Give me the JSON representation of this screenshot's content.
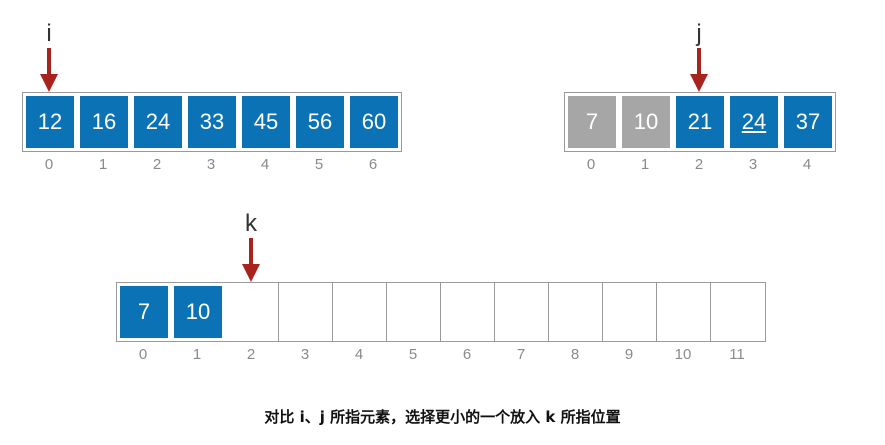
{
  "left": {
    "pointer": "i",
    "pointer_index": 0,
    "values": [
      "12",
      "16",
      "24",
      "33",
      "45",
      "56",
      "60"
    ],
    "indices": [
      "0",
      "1",
      "2",
      "3",
      "4",
      "5",
      "6"
    ]
  },
  "right": {
    "pointer": "j",
    "pointer_index": 2,
    "values": [
      "7",
      "10",
      "21",
      "24",
      "37"
    ],
    "indices": [
      "0",
      "1",
      "2",
      "3",
      "4"
    ],
    "consumed": 2,
    "underlined_index": 3
  },
  "merged": {
    "pointer": "k",
    "pointer_index": 2,
    "values": [
      "7",
      "10"
    ],
    "size": 12,
    "indices": [
      "0",
      "1",
      "2",
      "3",
      "4",
      "5",
      "6",
      "7",
      "8",
      "9",
      "10",
      "11"
    ]
  },
  "caption": "对比 i、j 所指元素，选择更小的一个放入 k 所指位置",
  "colors": {
    "filled": "#0b72b5",
    "consumed": "#a6a6a6",
    "pointer_arrow": "#a8231e"
  }
}
